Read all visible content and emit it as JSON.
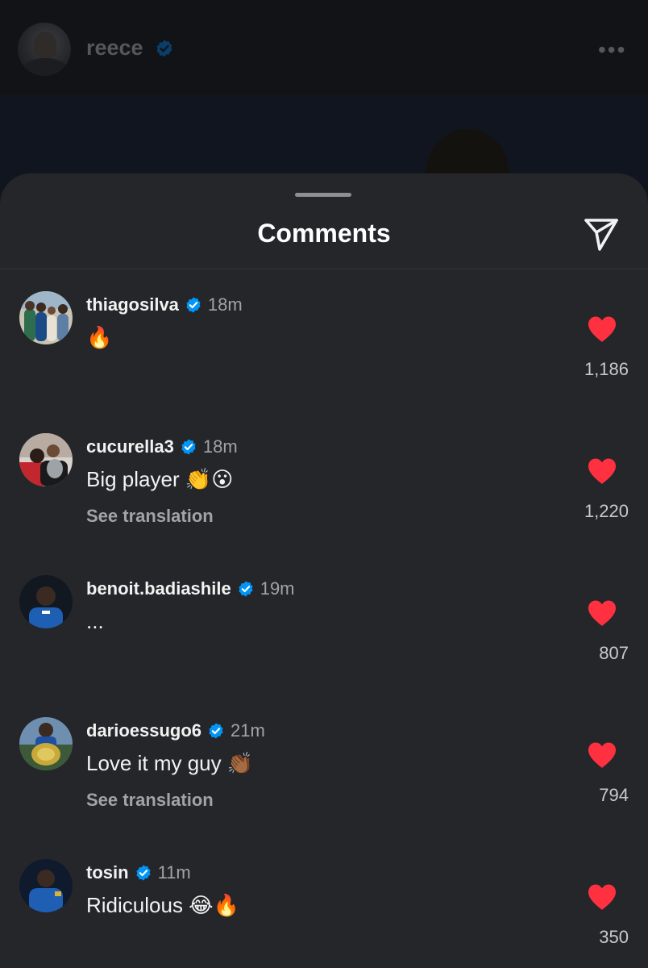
{
  "post": {
    "username": "reece",
    "verified": true,
    "more_icon": "more-horizontal-icon"
  },
  "sheet": {
    "title": "Comments",
    "share_icon": "send-paper-plane-icon"
  },
  "colors": {
    "sheet_bg": "#25262a",
    "verified_blue": "#0095f6",
    "like_red": "#ff3040",
    "secondary_text": "#a1a3a8"
  },
  "comments": [
    {
      "username": "thiagosilva",
      "time": "18m",
      "text": "🔥",
      "translation": "",
      "likes": "1,186",
      "liked": true
    },
    {
      "username": "cucurella3",
      "time": "18m",
      "text": "Big player 👏😮",
      "translation": "See translation",
      "likes": "1,220",
      "liked": true
    },
    {
      "username": "benoit.badiashile",
      "time": "19m",
      "text": "...",
      "translation": "",
      "likes": "807",
      "liked": true
    },
    {
      "username": "darioessugo6",
      "time": "21m",
      "text": "Love it my guy 👏🏾",
      "translation": "See translation",
      "likes": "794",
      "liked": true
    },
    {
      "username": "tosin",
      "time": "11m",
      "text": "Ridiculous 😂🔥",
      "translation": "",
      "likes": "350",
      "liked": true
    }
  ]
}
